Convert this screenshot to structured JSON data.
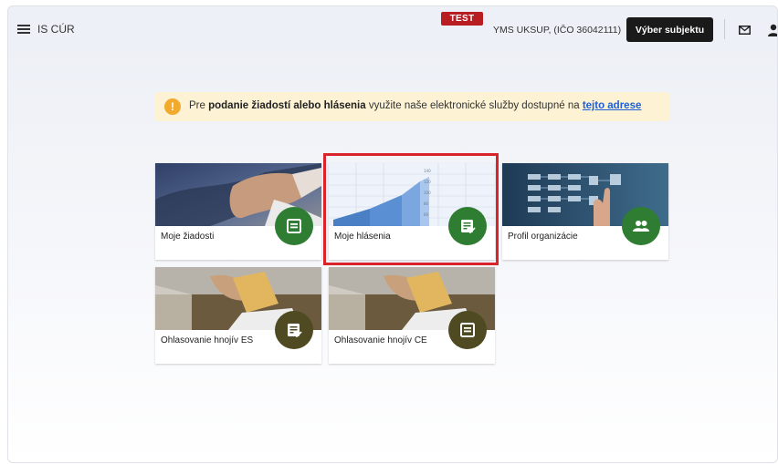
{
  "header": {
    "app_title": "IS CÚR",
    "env_badge": "TEST",
    "subject": "YMS UKSUP, (IČO 36042111)",
    "select_subject_label": "Výber subjektu",
    "icons": [
      "menu-icon",
      "mail-icon",
      "user-icon"
    ]
  },
  "notice": {
    "icon": "info-icon",
    "prefix": "Pre ",
    "bold": "podanie žiadostí alebo hlásenia",
    "middle": " využite naše elektronické služby dostupné na ",
    "link": "tejto adrese"
  },
  "tiles": [
    {
      "label": "Moje žiadosti",
      "icon": "form-icon"
    },
    {
      "label": "Moje hlásenia",
      "icon": "report-check-icon"
    },
    {
      "label": "Profil organizácie",
      "icon": "group-icon"
    },
    {
      "label": "Ohlasovanie hnojív ES",
      "icon": "report-check-icon"
    },
    {
      "label": "Ohlasovanie hnojív CE",
      "icon": "form-icon"
    }
  ],
  "colors": {
    "badge_green": "#2e7d32",
    "badge_olive": "#4f4a22",
    "test_red": "#b81d22",
    "highlight_red": "#d9242b",
    "notice_bg": "#fdf2d4",
    "link_blue": "#1c5fd6"
  }
}
